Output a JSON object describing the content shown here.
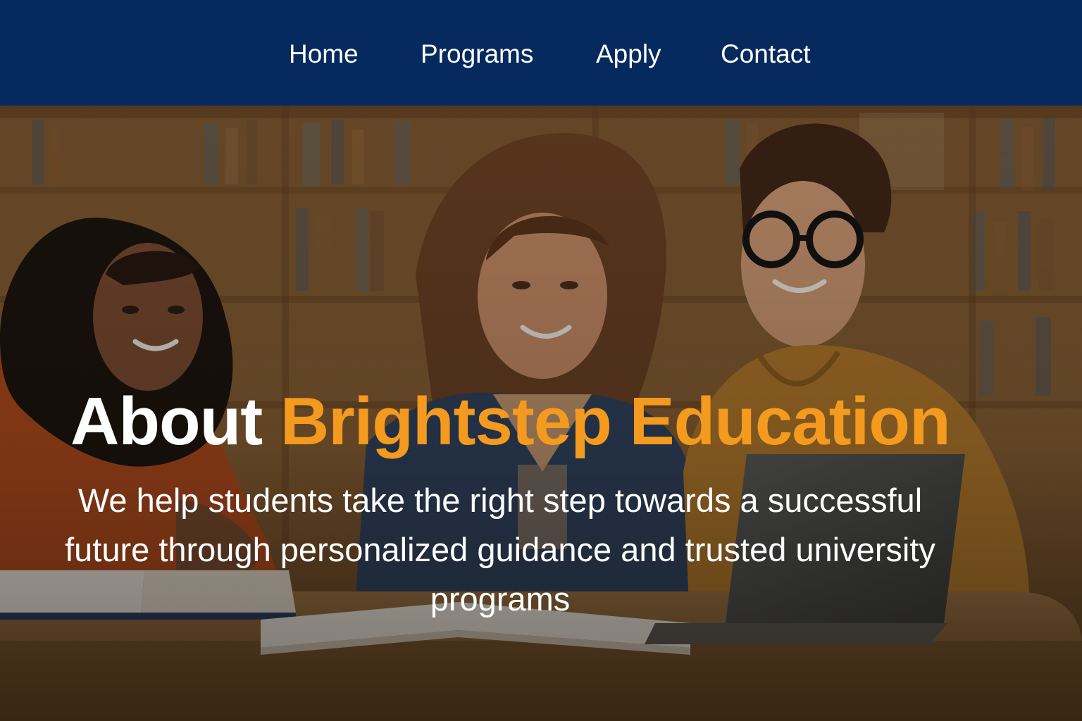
{
  "nav": {
    "items": [
      {
        "label": "Home"
      },
      {
        "label": "Programs"
      },
      {
        "label": "Apply"
      },
      {
        "label": "Contact"
      }
    ]
  },
  "hero": {
    "title_lead": "About",
    "title_highlight": "Brightstep Education",
    "subtitle": "We help students take the right step towards a successful future through personalized guidance and trusted university programs",
    "accent_color": "#f39a1f",
    "nav_color": "#062a5e",
    "image_subject": "Three smiling students studying together at a library table with open books and a laptop"
  }
}
